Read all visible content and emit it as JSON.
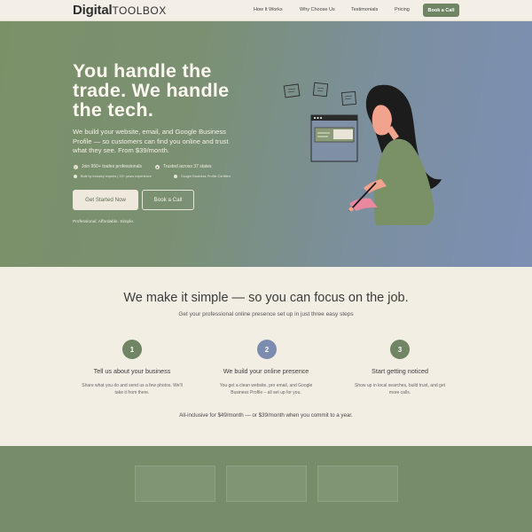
{
  "header": {
    "logo_main": "Digital",
    "logo_accent": "TOOLBOX",
    "nav": [
      "How It Works",
      "Why Choose Us",
      "Testimonials",
      "Pricing"
    ],
    "cta_label": "Book a Call"
  },
  "hero": {
    "title_lines": [
      "You handle the",
      "trade. We handle",
      "the tech."
    ],
    "subtitle_lines": [
      "We build your website, email, and Google Business",
      "Profile — so customers can find you online and trust",
      "what they see. From $39/month."
    ],
    "features": [
      "Join 950+ trades professionals",
      "Trusted across 37 states"
    ],
    "features_small": [
      "Built by industry experts | 15+ years experience",
      "Google Business Profile Certified"
    ],
    "primary_button": "Get Started Now",
    "secondary_button": "Book a Call",
    "tagline": "Professional. Affordable. Simple."
  },
  "steps": {
    "title": "We make it simple — so you can focus on the job.",
    "subtitle": "Get your professional online presence set up in just three easy steps",
    "items": [
      {
        "number": "1",
        "heading": "Tell us about your business",
        "desc_lines": [
          "Share what you do and send us a few photos. We'll",
          "take it from there."
        ],
        "color": "#6f8563"
      },
      {
        "number": "2",
        "heading": "We build your online presence",
        "desc_lines": [
          "You get a clean website, pro email, and Google",
          "Business Profile – all set up for you."
        ],
        "color": "#7c8cb0"
      },
      {
        "number": "3",
        "heading": "Start getting noticed",
        "desc_lines": [
          "Show up in local searches, build trust, and get",
          "more calls."
        ],
        "color": "#6f8563"
      }
    ],
    "pricing_note": "All-inclusive for $49/month — or $39/month when you commit to a year."
  },
  "colors": {
    "brand_green": "#6f8563",
    "brand_blue": "#7c8cb0",
    "cream": "#f3eee4"
  }
}
